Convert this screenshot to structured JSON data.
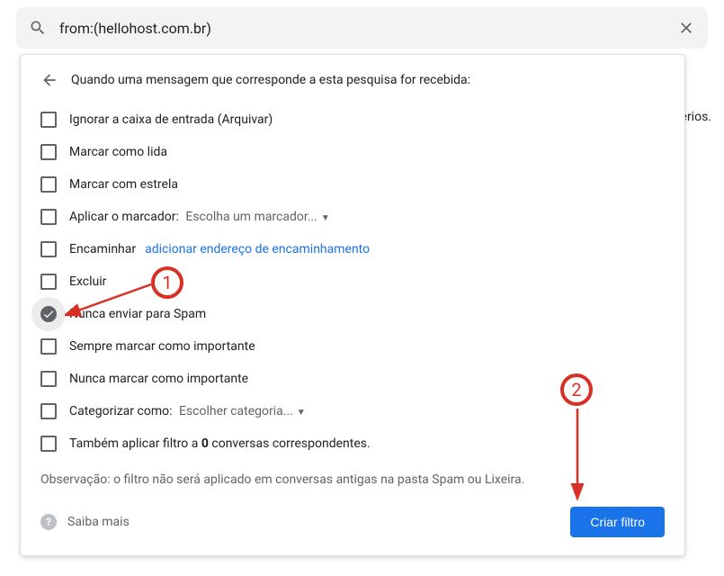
{
  "search": {
    "query": "from:(hellohost.com.br)"
  },
  "bg_text": "érios.",
  "panel": {
    "header": "Quando uma mensagem que corresponde a esta pesquisa for recebida:",
    "options": {
      "archive": "Ignorar a caixa de entrada (Arquivar)",
      "mark_read": "Marcar como lida",
      "star": "Marcar com estrela",
      "apply_label": "Aplicar o marcador:",
      "apply_label_select": "Escolha um marcador...",
      "forward": "Encaminhar",
      "forward_link": "adicionar endereço de encaminhamento",
      "delete": "Excluir",
      "never_spam": "Nunca enviar para Spam",
      "always_important": "Sempre marcar como importante",
      "never_important": "Nunca marcar como importante",
      "categorize": "Categorizar como:",
      "categorize_select": "Escolher categoria...",
      "apply_existing_pre": "Também aplicar filtro a ",
      "apply_existing_count": "0",
      "apply_existing_post": " conversas correspondentes."
    },
    "note": "Observação: o filtro não será aplicado em conversas antigas na pasta Spam ou Lixeira.",
    "learn_more": "Saiba mais",
    "create_button": "Criar filtro"
  },
  "annotations": {
    "one": "1",
    "two": "2"
  },
  "colors": {
    "accent": "#1a73e8",
    "annotation": "#d93025"
  }
}
